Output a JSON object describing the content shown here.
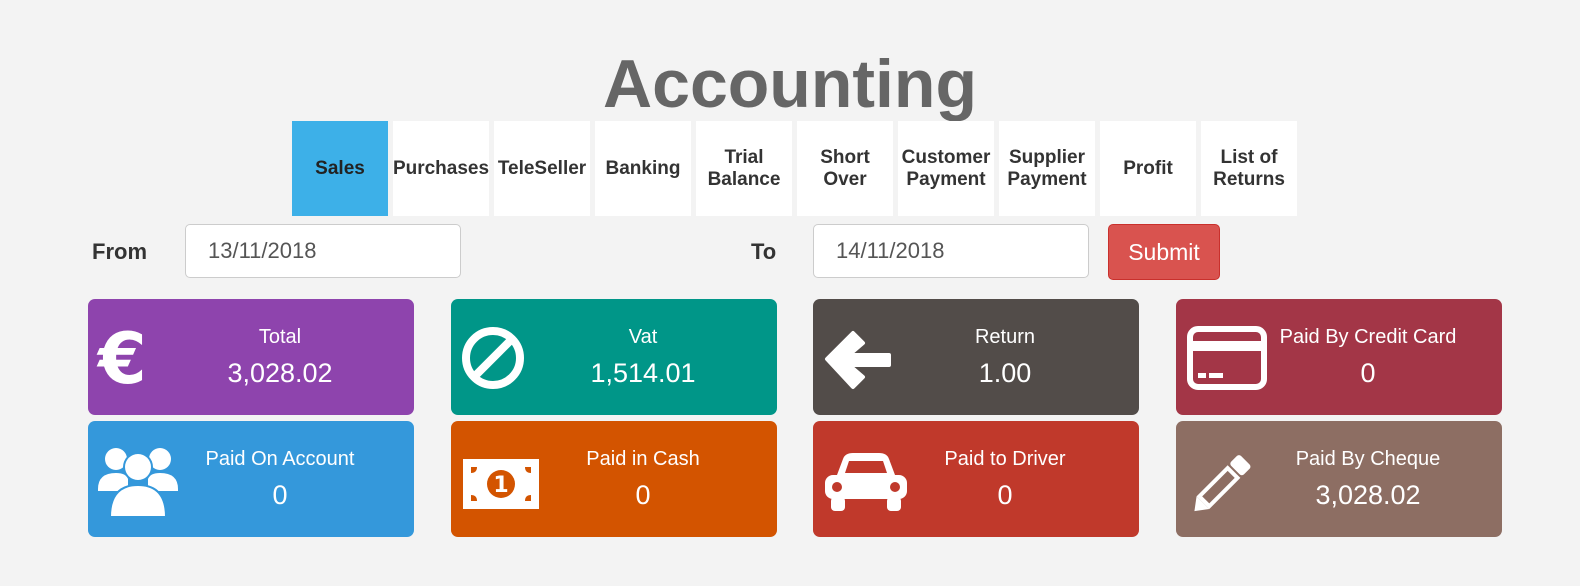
{
  "page": {
    "title": "Accounting"
  },
  "tabs": [
    {
      "label": "Sales",
      "active": true
    },
    {
      "label": "Purchases",
      "active": false
    },
    {
      "label": "TeleSeller",
      "active": false
    },
    {
      "label": "Banking",
      "active": false
    },
    {
      "label": "Trial\nBalance",
      "active": false
    },
    {
      "label": "Short\nOver",
      "active": false
    },
    {
      "label": "Customer\nPayment",
      "active": false
    },
    {
      "label": "Supplier\nPayment",
      "active": false
    },
    {
      "label": "Profit",
      "active": false
    },
    {
      "label": "List of\nReturns",
      "active": false
    }
  ],
  "filter": {
    "from_label": "From",
    "from_value": "13/11/2018",
    "to_label": "To",
    "to_value": "14/11/2018",
    "submit_label": "Submit"
  },
  "colors": {
    "accent_tab": "#3db0e8",
    "submit": "#d9534f"
  },
  "cards": [
    {
      "label": "Total",
      "value": "3,028.02",
      "icon": "euro-icon",
      "color": "#8e44ad"
    },
    {
      "label": "Vat",
      "value": "1,514.01",
      "icon": "ban-icon",
      "color": "#009688"
    },
    {
      "label": "Return",
      "value": "1.00",
      "icon": "arrow-left-icon",
      "color": "#524c49"
    },
    {
      "label": "Paid By Credit Card",
      "value": "0",
      "icon": "credit-card-icon",
      "color": "#a33647"
    },
    {
      "label": "Paid On Account",
      "value": "0",
      "icon": "users-icon",
      "color": "#3498db"
    },
    {
      "label": "Paid in Cash",
      "value": "0",
      "icon": "money-icon",
      "color": "#d35400"
    },
    {
      "label": "Paid to Driver",
      "value": "0",
      "icon": "car-icon",
      "color": "#c0392b"
    },
    {
      "label": "Paid By Cheque",
      "value": "3,028.02",
      "icon": "pencil-icon",
      "color": "#8d6e63"
    }
  ]
}
